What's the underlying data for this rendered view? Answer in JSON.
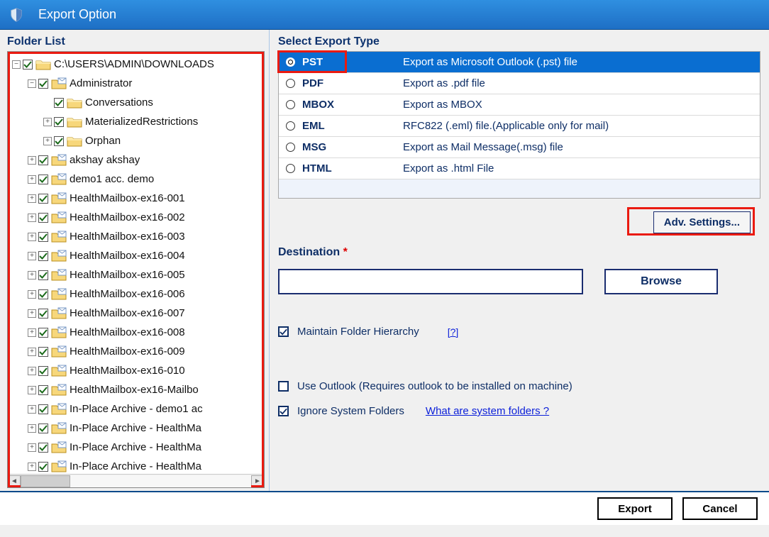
{
  "titlebar": {
    "title": "Export Option"
  },
  "left": {
    "title": "Folder List",
    "tree": [
      {
        "depth": 0,
        "exp": "minus",
        "kind": "open",
        "label": "C:\\USERS\\ADMIN\\DOWNLOADS"
      },
      {
        "depth": 1,
        "exp": "minus",
        "kind": "mbx",
        "label": "Administrator"
      },
      {
        "depth": 2,
        "exp": "none",
        "kind": "open",
        "label": "Conversations"
      },
      {
        "depth": 2,
        "exp": "plus",
        "kind": "open",
        "label": "MaterializedRestrictions"
      },
      {
        "depth": 2,
        "exp": "plus",
        "kind": "open",
        "label": "Orphan"
      },
      {
        "depth": 1,
        "exp": "plus",
        "kind": "mbx",
        "label": "akshay akshay"
      },
      {
        "depth": 1,
        "exp": "plus",
        "kind": "mbx",
        "label": "demo1 acc. demo"
      },
      {
        "depth": 1,
        "exp": "plus",
        "kind": "mbx",
        "label": "HealthMailbox-ex16-001"
      },
      {
        "depth": 1,
        "exp": "plus",
        "kind": "mbx",
        "label": "HealthMailbox-ex16-002"
      },
      {
        "depth": 1,
        "exp": "plus",
        "kind": "mbx",
        "label": "HealthMailbox-ex16-003"
      },
      {
        "depth": 1,
        "exp": "plus",
        "kind": "mbx",
        "label": "HealthMailbox-ex16-004"
      },
      {
        "depth": 1,
        "exp": "plus",
        "kind": "mbx",
        "label": "HealthMailbox-ex16-005"
      },
      {
        "depth": 1,
        "exp": "plus",
        "kind": "mbx",
        "label": "HealthMailbox-ex16-006"
      },
      {
        "depth": 1,
        "exp": "plus",
        "kind": "mbx",
        "label": "HealthMailbox-ex16-007"
      },
      {
        "depth": 1,
        "exp": "plus",
        "kind": "mbx",
        "label": "HealthMailbox-ex16-008"
      },
      {
        "depth": 1,
        "exp": "plus",
        "kind": "mbx",
        "label": "HealthMailbox-ex16-009"
      },
      {
        "depth": 1,
        "exp": "plus",
        "kind": "mbx",
        "label": "HealthMailbox-ex16-010"
      },
      {
        "depth": 1,
        "exp": "plus",
        "kind": "mbx",
        "label": "HealthMailbox-ex16-Mailbo"
      },
      {
        "depth": 1,
        "exp": "plus",
        "kind": "mbx",
        "label": "In-Place Archive - demo1 ac"
      },
      {
        "depth": 1,
        "exp": "plus",
        "kind": "mbx",
        "label": "In-Place Archive - HealthMa"
      },
      {
        "depth": 1,
        "exp": "plus",
        "kind": "mbx",
        "label": "In-Place Archive - HealthMa"
      },
      {
        "depth": 1,
        "exp": "plus",
        "kind": "mbx",
        "label": "In-Place Archive - HealthMa"
      }
    ]
  },
  "right": {
    "title": "Select Export Type",
    "types": [
      {
        "code": "PST",
        "desc": "Export as Microsoft Outlook (.pst) file",
        "selected": true
      },
      {
        "code": "PDF",
        "desc": "Export as .pdf file",
        "selected": false
      },
      {
        "code": "MBOX",
        "desc": "Export as MBOX",
        "selected": false
      },
      {
        "code": "EML",
        "desc": "RFC822 (.eml) file.(Applicable only for mail)",
        "selected": false
      },
      {
        "code": "MSG",
        "desc": "Export as Mail Message(.msg) file",
        "selected": false
      },
      {
        "code": "HTML",
        "desc": "Export as .html File",
        "selected": false
      }
    ],
    "adv_label": "Adv. Settings...",
    "dest_label": "Destination",
    "dest_value": "",
    "browse_label": "Browse",
    "maintain_label": "Maintain Folder Hierarchy",
    "maintain_help": "[?]",
    "use_outlook_label": "Use Outlook (Requires outlook to be installed on machine)",
    "ignore_label": "Ignore System Folders",
    "ignore_link": "What are system folders ?"
  },
  "footer": {
    "export": "Export",
    "cancel": "Cancel"
  }
}
